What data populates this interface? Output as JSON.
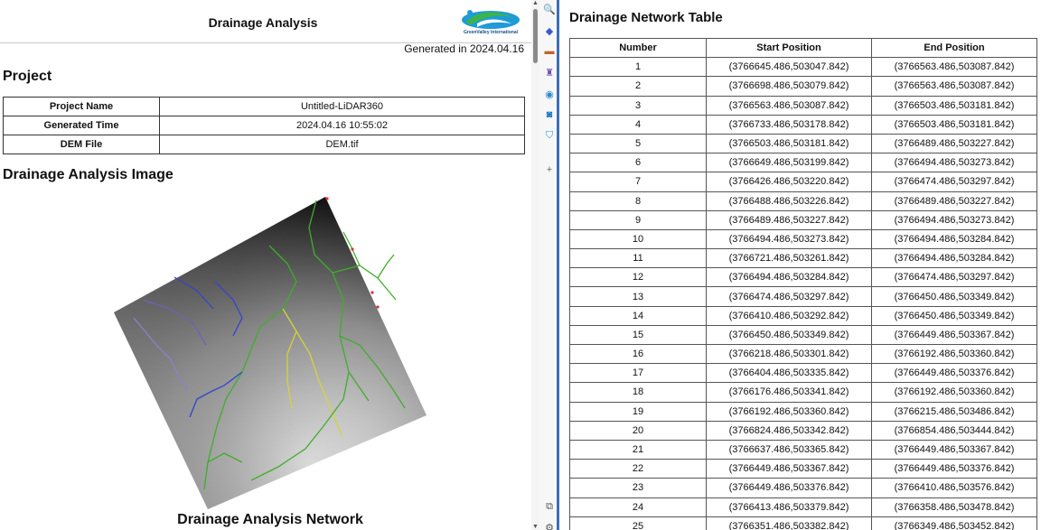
{
  "report": {
    "title": "Drainage Analysis",
    "logo_text": "GreenValley International",
    "generated": "Generated in 2024.04.16",
    "project_heading": "Project",
    "project": [
      {
        "key": "Project Name",
        "value": "Untitled-LiDAR360"
      },
      {
        "key": "Generated Time",
        "value": "2024.04.16 10:55:02"
      },
      {
        "key": "DEM File",
        "value": "DEM.tif"
      }
    ],
    "image_heading": "Drainage Analysis Image",
    "image_caption": "Drainage Analysis Network"
  },
  "network": {
    "title": "Drainage Network Table",
    "headers": [
      "Number",
      "Start Position",
      "End Position"
    ],
    "rows": [
      [
        "1",
        "(3766645.486,503047.842)",
        "(3766563.486,503087.842)"
      ],
      [
        "2",
        "(3766698.486,503079.842)",
        "(3766563.486,503087.842)"
      ],
      [
        "3",
        "(3766563.486,503087.842)",
        "(3766503.486,503181.842)"
      ],
      [
        "4",
        "(3766733.486,503178.842)",
        "(3766503.486,503181.842)"
      ],
      [
        "5",
        "(3766503.486,503181.842)",
        "(3766489.486,503227.842)"
      ],
      [
        "6",
        "(3766649.486,503199.842)",
        "(3766494.486,503273.842)"
      ],
      [
        "7",
        "(3766426.486,503220.842)",
        "(3766474.486,503297.842)"
      ],
      [
        "8",
        "(3766488.486,503226.842)",
        "(3766489.486,503227.842)"
      ],
      [
        "9",
        "(3766489.486,503227.842)",
        "(3766494.486,503273.842)"
      ],
      [
        "10",
        "(3766494.486,503273.842)",
        "(3766494.486,503284.842)"
      ],
      [
        "11",
        "(3766721.486,503261.842)",
        "(3766494.486,503284.842)"
      ],
      [
        "12",
        "(3766494.486,503284.842)",
        "(3766474.486,503297.842)"
      ],
      [
        "13",
        "(3766474.486,503297.842)",
        "(3766450.486,503349.842)"
      ],
      [
        "14",
        "(3766410.486,503292.842)",
        "(3766450.486,503349.842)"
      ],
      [
        "15",
        "(3766450.486,503349.842)",
        "(3766449.486,503367.842)"
      ],
      [
        "16",
        "(3766218.486,503301.842)",
        "(3766192.486,503360.842)"
      ],
      [
        "17",
        "(3766404.486,503335.842)",
        "(3766449.486,503376.842)"
      ],
      [
        "18",
        "(3766176.486,503341.842)",
        "(3766192.486,503360.842)"
      ],
      [
        "19",
        "(3766192.486,503360.842)",
        "(3766215.486,503486.842)"
      ],
      [
        "20",
        "(3766824.486,503342.842)",
        "(3766854.486,503444.842)"
      ],
      [
        "21",
        "(3766637.486,503365.842)",
        "(3766449.486,503367.842)"
      ],
      [
        "22",
        "(3766449.486,503367.842)",
        "(3766449.486,503376.842)"
      ],
      [
        "23",
        "(3766449.486,503376.842)",
        "(3766410.486,503576.842)"
      ],
      [
        "24",
        "(3766413.486,503379.842)",
        "(3766358.486,503478.842)"
      ],
      [
        "25",
        "(3766351.486,503382.842)",
        "(3766349.486,503452.842)"
      ]
    ]
  },
  "toolbar": {
    "icons": [
      "search-icon",
      "tag-icon",
      "briefcase-icon",
      "chess-icon",
      "copilot-icon",
      "outlook-icon",
      "shopping-icon",
      "add-icon",
      "screenshot-icon",
      "settings-icon"
    ]
  },
  "colors": {
    "accent": "#3b6fb6",
    "stream_green": "#3fae2a",
    "stream_blue": "#3344cc",
    "stream_yellow": "#d7d23a"
  }
}
